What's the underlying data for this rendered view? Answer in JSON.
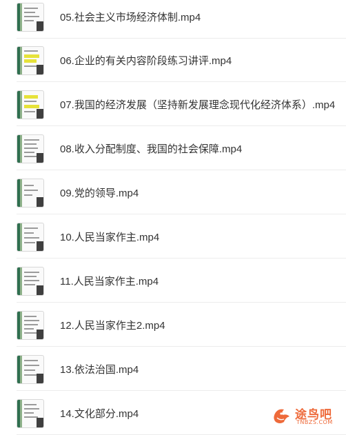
{
  "files": [
    {
      "name": "05.社会主义市场经济体制.mp4",
      "highlight": false
    },
    {
      "name": "06.企业的有关内容阶段练习讲评.mp4",
      "highlight": true
    },
    {
      "name": "07.我国的经济发展（坚持新发展理念现代化经济体系）.mp4",
      "highlight": true
    },
    {
      "name": "08.收入分配制度、我国的社会保障.mp4",
      "highlight": false
    },
    {
      "name": "09.党的领导.mp4",
      "highlight": false
    },
    {
      "name": "10.人民当家作主.mp4",
      "highlight": false
    },
    {
      "name": "11.人民当家作主.mp4",
      "highlight": false
    },
    {
      "name": "12.人民当家作主2.mp4",
      "highlight": false
    },
    {
      "name": "13.依法治国.mp4",
      "highlight": false
    },
    {
      "name": "14.文化部分.mp4",
      "highlight": false
    }
  ],
  "watermark": {
    "text": "途鸟吧",
    "sub": "TNBZS.COM",
    "color": "#ee6a3a"
  }
}
